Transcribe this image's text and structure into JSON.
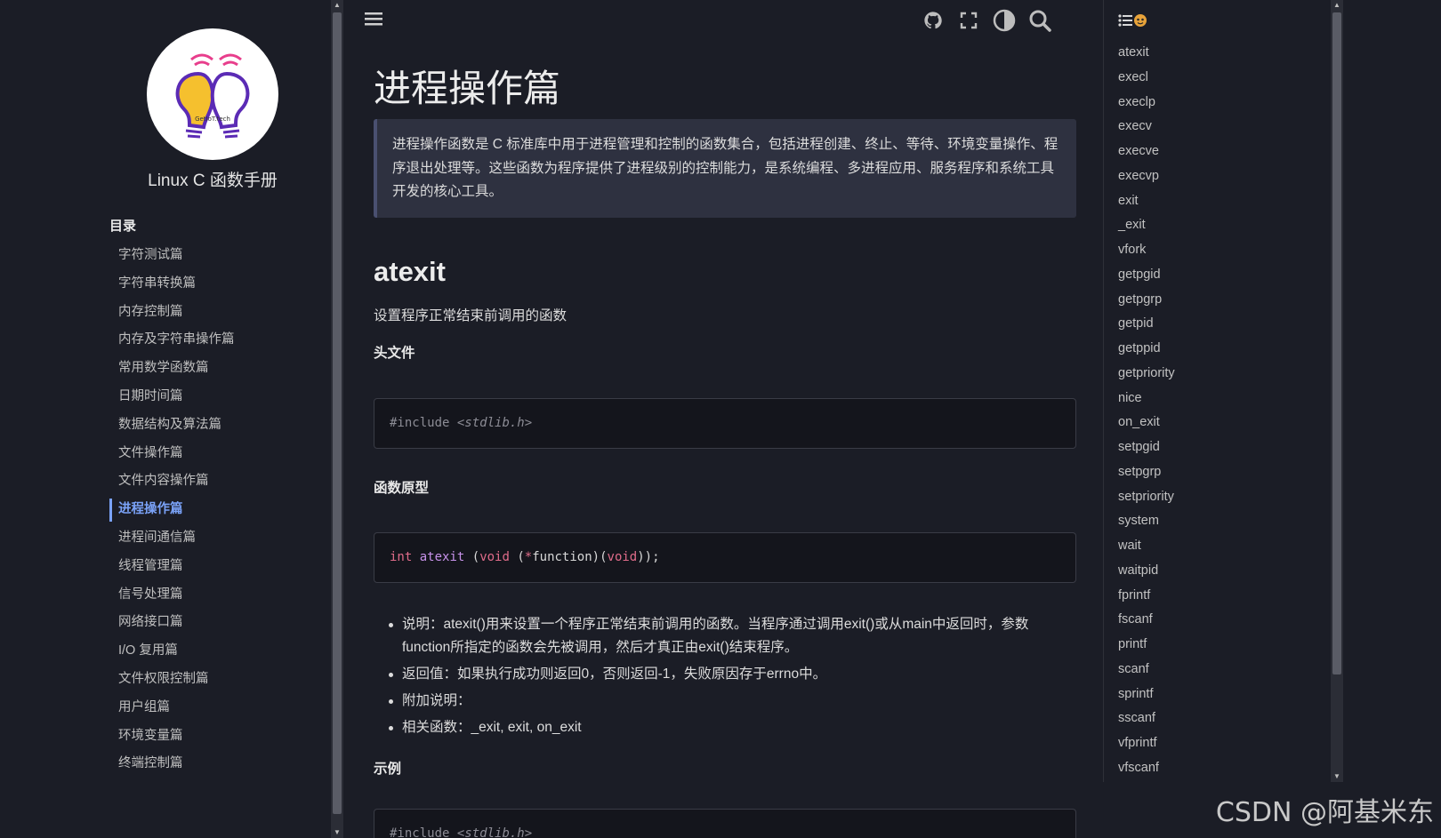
{
  "sidebar": {
    "logo_text": "GetIoT.tech",
    "app_title": "Linux C 函数手册",
    "toc_heading": "目录",
    "items": [
      {
        "label": "字符测试篇"
      },
      {
        "label": "字符串转换篇"
      },
      {
        "label": "内存控制篇"
      },
      {
        "label": "内存及字符串操作篇"
      },
      {
        "label": "常用数学函数篇"
      },
      {
        "label": "日期时间篇"
      },
      {
        "label": "数据结构及算法篇"
      },
      {
        "label": "文件操作篇"
      },
      {
        "label": "文件内容操作篇"
      },
      {
        "label": "进程操作篇",
        "active": true
      },
      {
        "label": "进程间通信篇"
      },
      {
        "label": "线程管理篇"
      },
      {
        "label": "信号处理篇"
      },
      {
        "label": "网络接口篇"
      },
      {
        "label": "I/O 复用篇"
      },
      {
        "label": "文件权限控制篇"
      },
      {
        "label": "用户组篇"
      },
      {
        "label": "环境变量篇"
      },
      {
        "label": "终端控制篇"
      }
    ]
  },
  "topbar": {
    "icons": [
      "menu-icon",
      "github-icon",
      "fullscreen-icon",
      "theme-toggle-icon",
      "search-icon"
    ]
  },
  "main": {
    "title": "进程操作篇",
    "intro": "进程操作函数是 C 标准库中用于进程管理和控制的函数集合，包括进程创建、终止、等待、环境变量操作、程序退出处理等。这些函数为程序提供了进程级别的控制能力，是系统编程、多进程应用、服务程序和系统工具开发的核心工具。",
    "section_title": "atexit",
    "section_desc": "设置程序正常结束前调用的函数",
    "header_heading": "头文件",
    "header_code": {
      "directive": "#include",
      "file": "<stdlib.h>"
    },
    "proto_heading": "函数原型",
    "proto_code": {
      "ret": "int",
      "name": "atexit",
      "p1": "(",
      "kw1": "void",
      "p2": "(",
      "star": "*",
      "arg": "function)(",
      "kw2": "void",
      "p3": "));"
    },
    "bullets": [
      "说明：atexit()用来设置一个程序正常结束前调用的函数。当程序通过调用exit()或从main中返回时，参数function所指定的函数会先被调用，然后才真正由exit()结束程序。",
      "返回值：如果执行成功则返回0，否则返回-1，失败原因存于errno中。",
      "附加说明：",
      "相关函数：_exit, exit, on_exit"
    ],
    "example_heading": "示例",
    "example_code": {
      "directive": "#include",
      "file": "<stdlib.h>"
    }
  },
  "right_toc": {
    "icon": "list-icon",
    "items": [
      "atexit",
      "execl",
      "execlp",
      "execv",
      "execve",
      "execvp",
      "exit",
      "_exit",
      "vfork",
      "getpgid",
      "getpgrp",
      "getpid",
      "getppid",
      "getpriority",
      "nice",
      "on_exit",
      "setpgid",
      "setpgrp",
      "setpriority",
      "system",
      "wait",
      "waitpid",
      "fprintf",
      "fscanf",
      "printf",
      "scanf",
      "sprintf",
      "sscanf",
      "vfprintf",
      "vfscanf"
    ]
  },
  "watermark": "CSDN @阿基米东",
  "colors": {
    "background": "#1b1d26",
    "accent": "#7aa2f7",
    "keyword": "#e06c8a",
    "function": "#c792ea"
  }
}
